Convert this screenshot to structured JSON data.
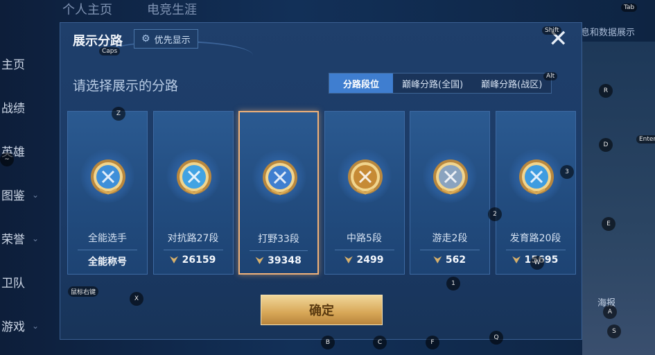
{
  "top_nav": [
    "个人主页",
    "电竞生涯"
  ],
  "side_nav": [
    {
      "label": "主页"
    },
    {
      "label": "战绩"
    },
    {
      "label": "英雄"
    },
    {
      "label": "图鉴"
    },
    {
      "label": "荣誉"
    },
    {
      "label": "卫队"
    },
    {
      "label": "游戏"
    }
  ],
  "right_text": "息和数据展示",
  "right_button": "海报",
  "dialog": {
    "title": "展示分路",
    "priority_label": "优先显示",
    "subtitle": "请选择展示的分路",
    "tabs": [
      "分路段位",
      "巅峰分路(全国)",
      "巅峰分路(战区)"
    ],
    "active_tab": 0,
    "confirm_label": "确定"
  },
  "cards": [
    {
      "position": "全能选手",
      "score": "全能称号",
      "has_score_icon": false,
      "selected": false,
      "medal_color": "#3e8fd9"
    },
    {
      "position": "对抗路27段",
      "score": "26159",
      "has_score_icon": true,
      "selected": false,
      "medal_color": "#42a3e3"
    },
    {
      "position": "打野33段",
      "score": "39348",
      "has_score_icon": true,
      "selected": true,
      "medal_color": "#3f7fd0"
    },
    {
      "position": "中路5段",
      "score": "2499",
      "has_score_icon": true,
      "selected": false,
      "medal_color": "#c68a35"
    },
    {
      "position": "游走2段",
      "score": "562",
      "has_score_icon": true,
      "selected": false,
      "medal_color": "#8aa3bf"
    },
    {
      "position": "发育路20段",
      "score": "15695",
      "has_score_icon": true,
      "selected": false,
      "medal_color": "#3e9ce0"
    }
  ],
  "key_hints": [
    "Tab",
    "Shift",
    "Caps",
    "Alt",
    "R",
    "D",
    "Enter",
    "Z",
    "~",
    "3",
    "2",
    "E",
    "W",
    "1",
    "X",
    "鼠标右键",
    "A",
    "S",
    "B",
    "C",
    "F",
    "Q"
  ],
  "colors": {
    "accent": "#3f7ed0",
    "selected_border": "#f0b27a",
    "confirm": "#d7a757"
  }
}
